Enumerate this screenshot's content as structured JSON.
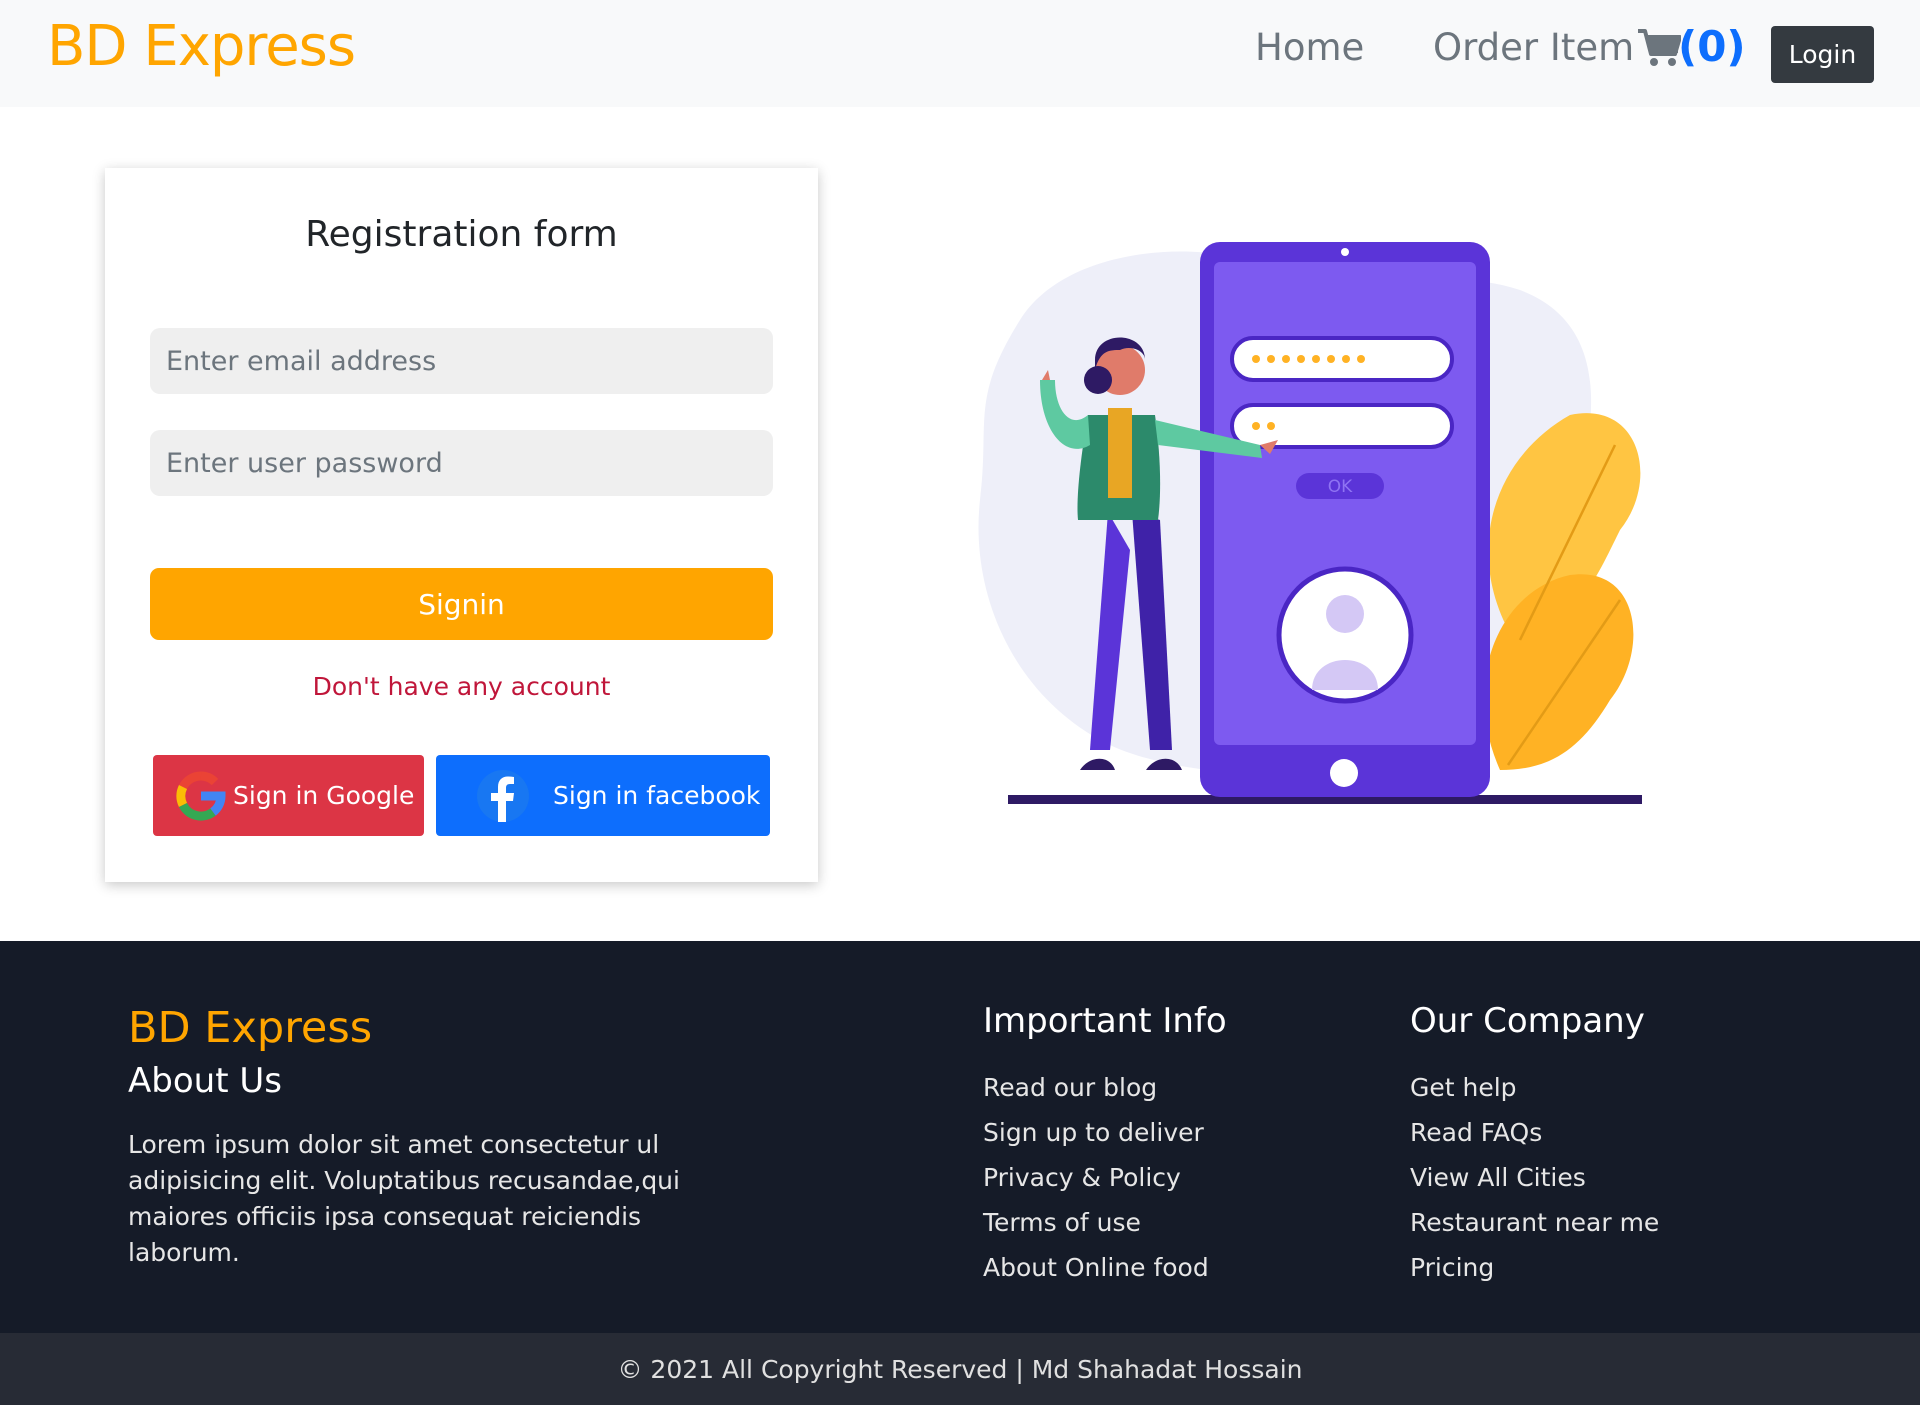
{
  "navbar": {
    "brand": "BD Express",
    "home": "Home",
    "order_item": "Order Item",
    "cart_count": "(0)",
    "login": "Login"
  },
  "form": {
    "title": "Registration form",
    "email_placeholder": "Enter email address",
    "password_placeholder": "Enter user password",
    "signin": "Signin",
    "no_account": "Don't have any account",
    "google": "Sign in Google",
    "facebook": "Sign in facebook"
  },
  "illustration": {
    "ok_label": "OK"
  },
  "footer": {
    "brand": "BD Express",
    "about_title": "About Us",
    "about_text": "Lorem ipsum dolor sit amet consectetur ul adipisicing elit. Voluptatibus recusandae,qui maiores officiis ipsa consequat reiciendis laborum.",
    "important_title": "Important Info",
    "important_links": [
      "Read our blog",
      "Sign up to deliver",
      "Privacy & Policy",
      "Terms of use",
      "About Online food"
    ],
    "company_title": "Our Company",
    "company_links": [
      "Get help",
      "Read FAQs",
      "View All Cities",
      "Restaurant near me",
      "Pricing"
    ],
    "copyright": "© 2021 All Copyright Reserved | Md Shahadat Hossain"
  },
  "colors": {
    "accent": "#ffa500",
    "dark": "#151b28",
    "danger": "#dc3545",
    "primary": "#0d6efd"
  }
}
